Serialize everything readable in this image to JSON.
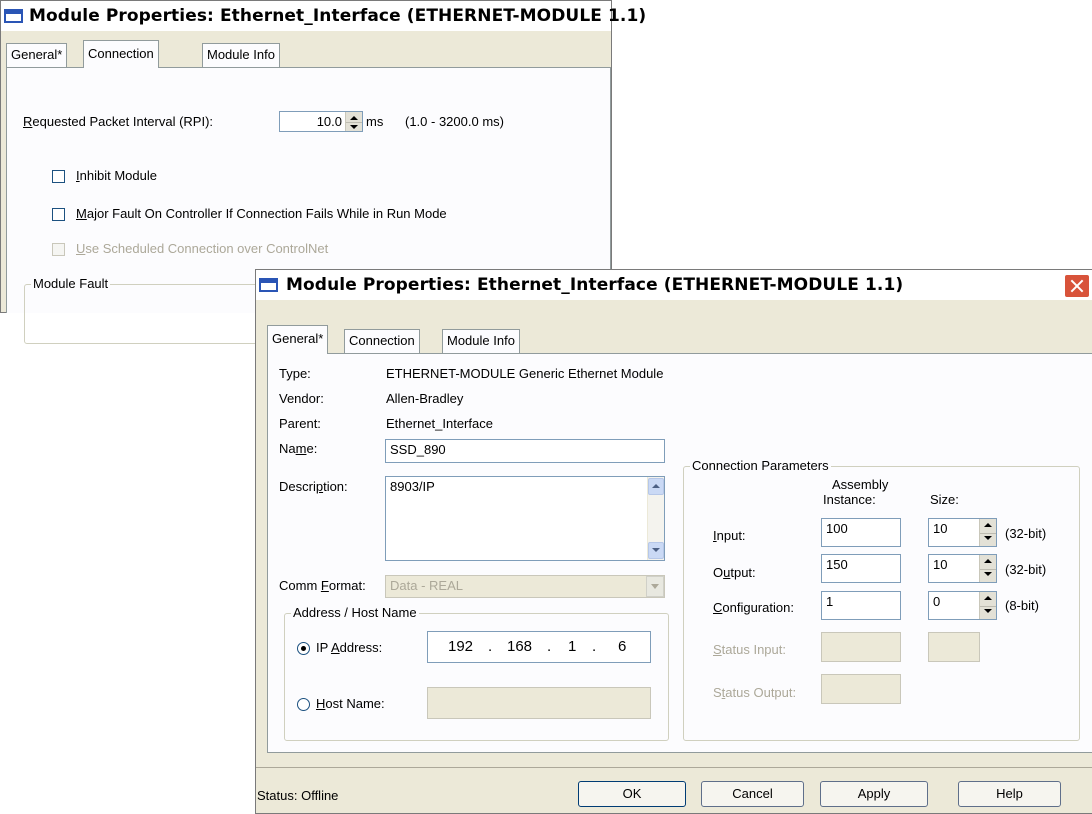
{
  "back_window": {
    "title": "Module Properties: Ethernet_Interface (ETHERNET-MODULE 1.1)",
    "tabs": [
      "General*",
      "Connection",
      "Module Info"
    ],
    "active_tab": "Connection",
    "rpi": {
      "label": "Requested Packet Interval (RPI):",
      "mnemonic": "R",
      "value": "10.0",
      "unit": "ms",
      "range": "(1.0 - 3200.0 ms)"
    },
    "inhibit": {
      "label": "Inhibit Module",
      "mnemonic": "I",
      "checked": false
    },
    "major_fault": {
      "label": "Major Fault On Controller If Connection Fails While in Run Mode",
      "mnemonic": "M",
      "checked": false
    },
    "scheduled": {
      "label": "Use Scheduled Connection over ControlNet",
      "mnemonic": "U",
      "checked": false,
      "disabled": true
    },
    "module_fault_group": "Module Fault"
  },
  "front_window": {
    "title": "Module Properties: Ethernet_Interface (ETHERNET-MODULE 1.1)",
    "tabs": [
      "General*",
      "Connection",
      "Module Info"
    ],
    "active_tab": "General*",
    "type": {
      "label": "Type:",
      "value": "ETHERNET-MODULE Generic Ethernet Module"
    },
    "vendor": {
      "label": "Vendor:",
      "value": "Allen-Bradley"
    },
    "parent": {
      "label": "Parent:",
      "value": "Ethernet_Interface"
    },
    "name": {
      "label_a": "Na",
      "label_m": "m",
      "label_b": "e:",
      "value": "SSD_890"
    },
    "description": {
      "label_a": "Descri",
      "label_m": "p",
      "label_b": "tion:",
      "value": "8903/IP"
    },
    "comm_format": {
      "label_a": "Comm ",
      "label_m": "F",
      "label_b": "ormat:",
      "value": "Data - REAL"
    },
    "address_group": "Address / Host Name",
    "ip_address": {
      "label_a": "IP ",
      "label_m": "A",
      "label_b": "ddress:",
      "octets": [
        "192",
        "168",
        "1",
        "6"
      ],
      "selected": true
    },
    "host_name": {
      "label_m": "H",
      "label_b": "ost Name:",
      "value": "",
      "selected": false
    },
    "connection_group": "Connection Parameters",
    "col_assembly_1": "Assembly",
    "col_assembly_2": "Instance:",
    "col_size": "Size:",
    "input": {
      "label_m": "I",
      "label_b": "nput:",
      "instance": "100",
      "size": "10",
      "unit": "(32-bit)"
    },
    "output": {
      "label_a": "O",
      "label_m": "u",
      "label_b": "tput:",
      "instance": "150",
      "size": "10",
      "unit": "(32-bit)"
    },
    "configuration": {
      "label_m": "C",
      "label_b": "onfiguration:",
      "instance": "1",
      "size": "0",
      "unit": "(8-bit)"
    },
    "status_input": {
      "label_m": "S",
      "label_b": "tatus Input:"
    },
    "status_output": {
      "label_a": "S",
      "label_m": "t",
      "label_b": "atus Output:"
    },
    "status": "Status:  Offline",
    "buttons": {
      "ok": "OK",
      "cancel": "Cancel",
      "apply": "Apply",
      "help": "Help"
    }
  }
}
